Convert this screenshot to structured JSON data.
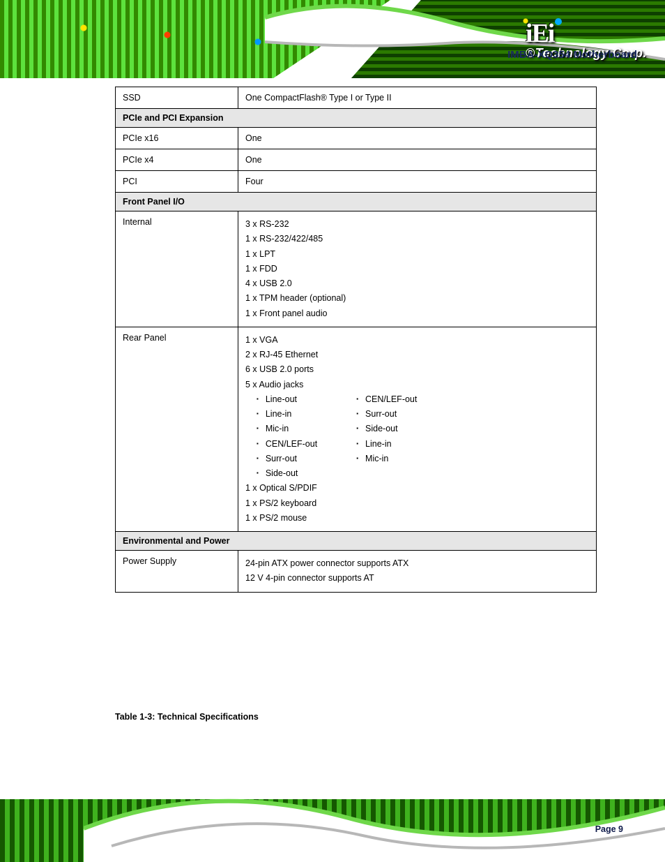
{
  "header": {
    "brand_top": "iEi",
    "brand_sub": "®Technology Corp.",
    "doc_title": "IMBA-XQ354 Motherboard"
  },
  "table": {
    "row_ssd": {
      "label": "SSD",
      "value": "One CompactFlash® Type I or Type II"
    },
    "section_pcie": "PCIe and PCI Expansion",
    "row_pcie16": {
      "label": "PCIe x16",
      "value": "One"
    },
    "row_pcie4": {
      "label": "PCIe x4",
      "value": "One"
    },
    "row_pci": {
      "label": "PCI",
      "value": "Four"
    },
    "section_fp": "Front Panel I/O",
    "row_fp_internal": {
      "label": "Internal",
      "lines": [
        "3 x RS-232",
        "1 x RS-232/422/485",
        "1 x LPT",
        "1 x FDD",
        "4 x USB 2.0",
        "1 x TPM header (optional)",
        "1 x Front panel audio"
      ]
    },
    "row_fp_rear": {
      "label": "Rear Panel",
      "head_lines": [
        "1 x VGA",
        "2 x RJ-45 Ethernet",
        "6 x USB 2.0 ports"
      ],
      "audio_intro": "5 x Audio jacks",
      "audio_left": [
        "Line-out",
        "Line-in",
        "Mic-in",
        "CEN/LEF-out",
        "Surr-out",
        "Side-out"
      ],
      "audio_right": [
        "CEN/LEF-out",
        "Surr-out",
        "Side-out",
        "Line-in",
        "Mic-in"
      ],
      "tail_lines": [
        "1 x Optical S/PDIF",
        "1 x PS/2 keyboard",
        "1 x PS/2 mouse"
      ]
    },
    "section_env": "Environmental and Power",
    "row_power": {
      "label": "Power Supply",
      "value_l1": "24-pin ATX power connector supports ATX",
      "value_l2": "12 V 4-pin connector supports AT"
    }
  },
  "caption": "Table 1-3: Technical Specifications",
  "footer": {
    "text": "Page 9"
  }
}
